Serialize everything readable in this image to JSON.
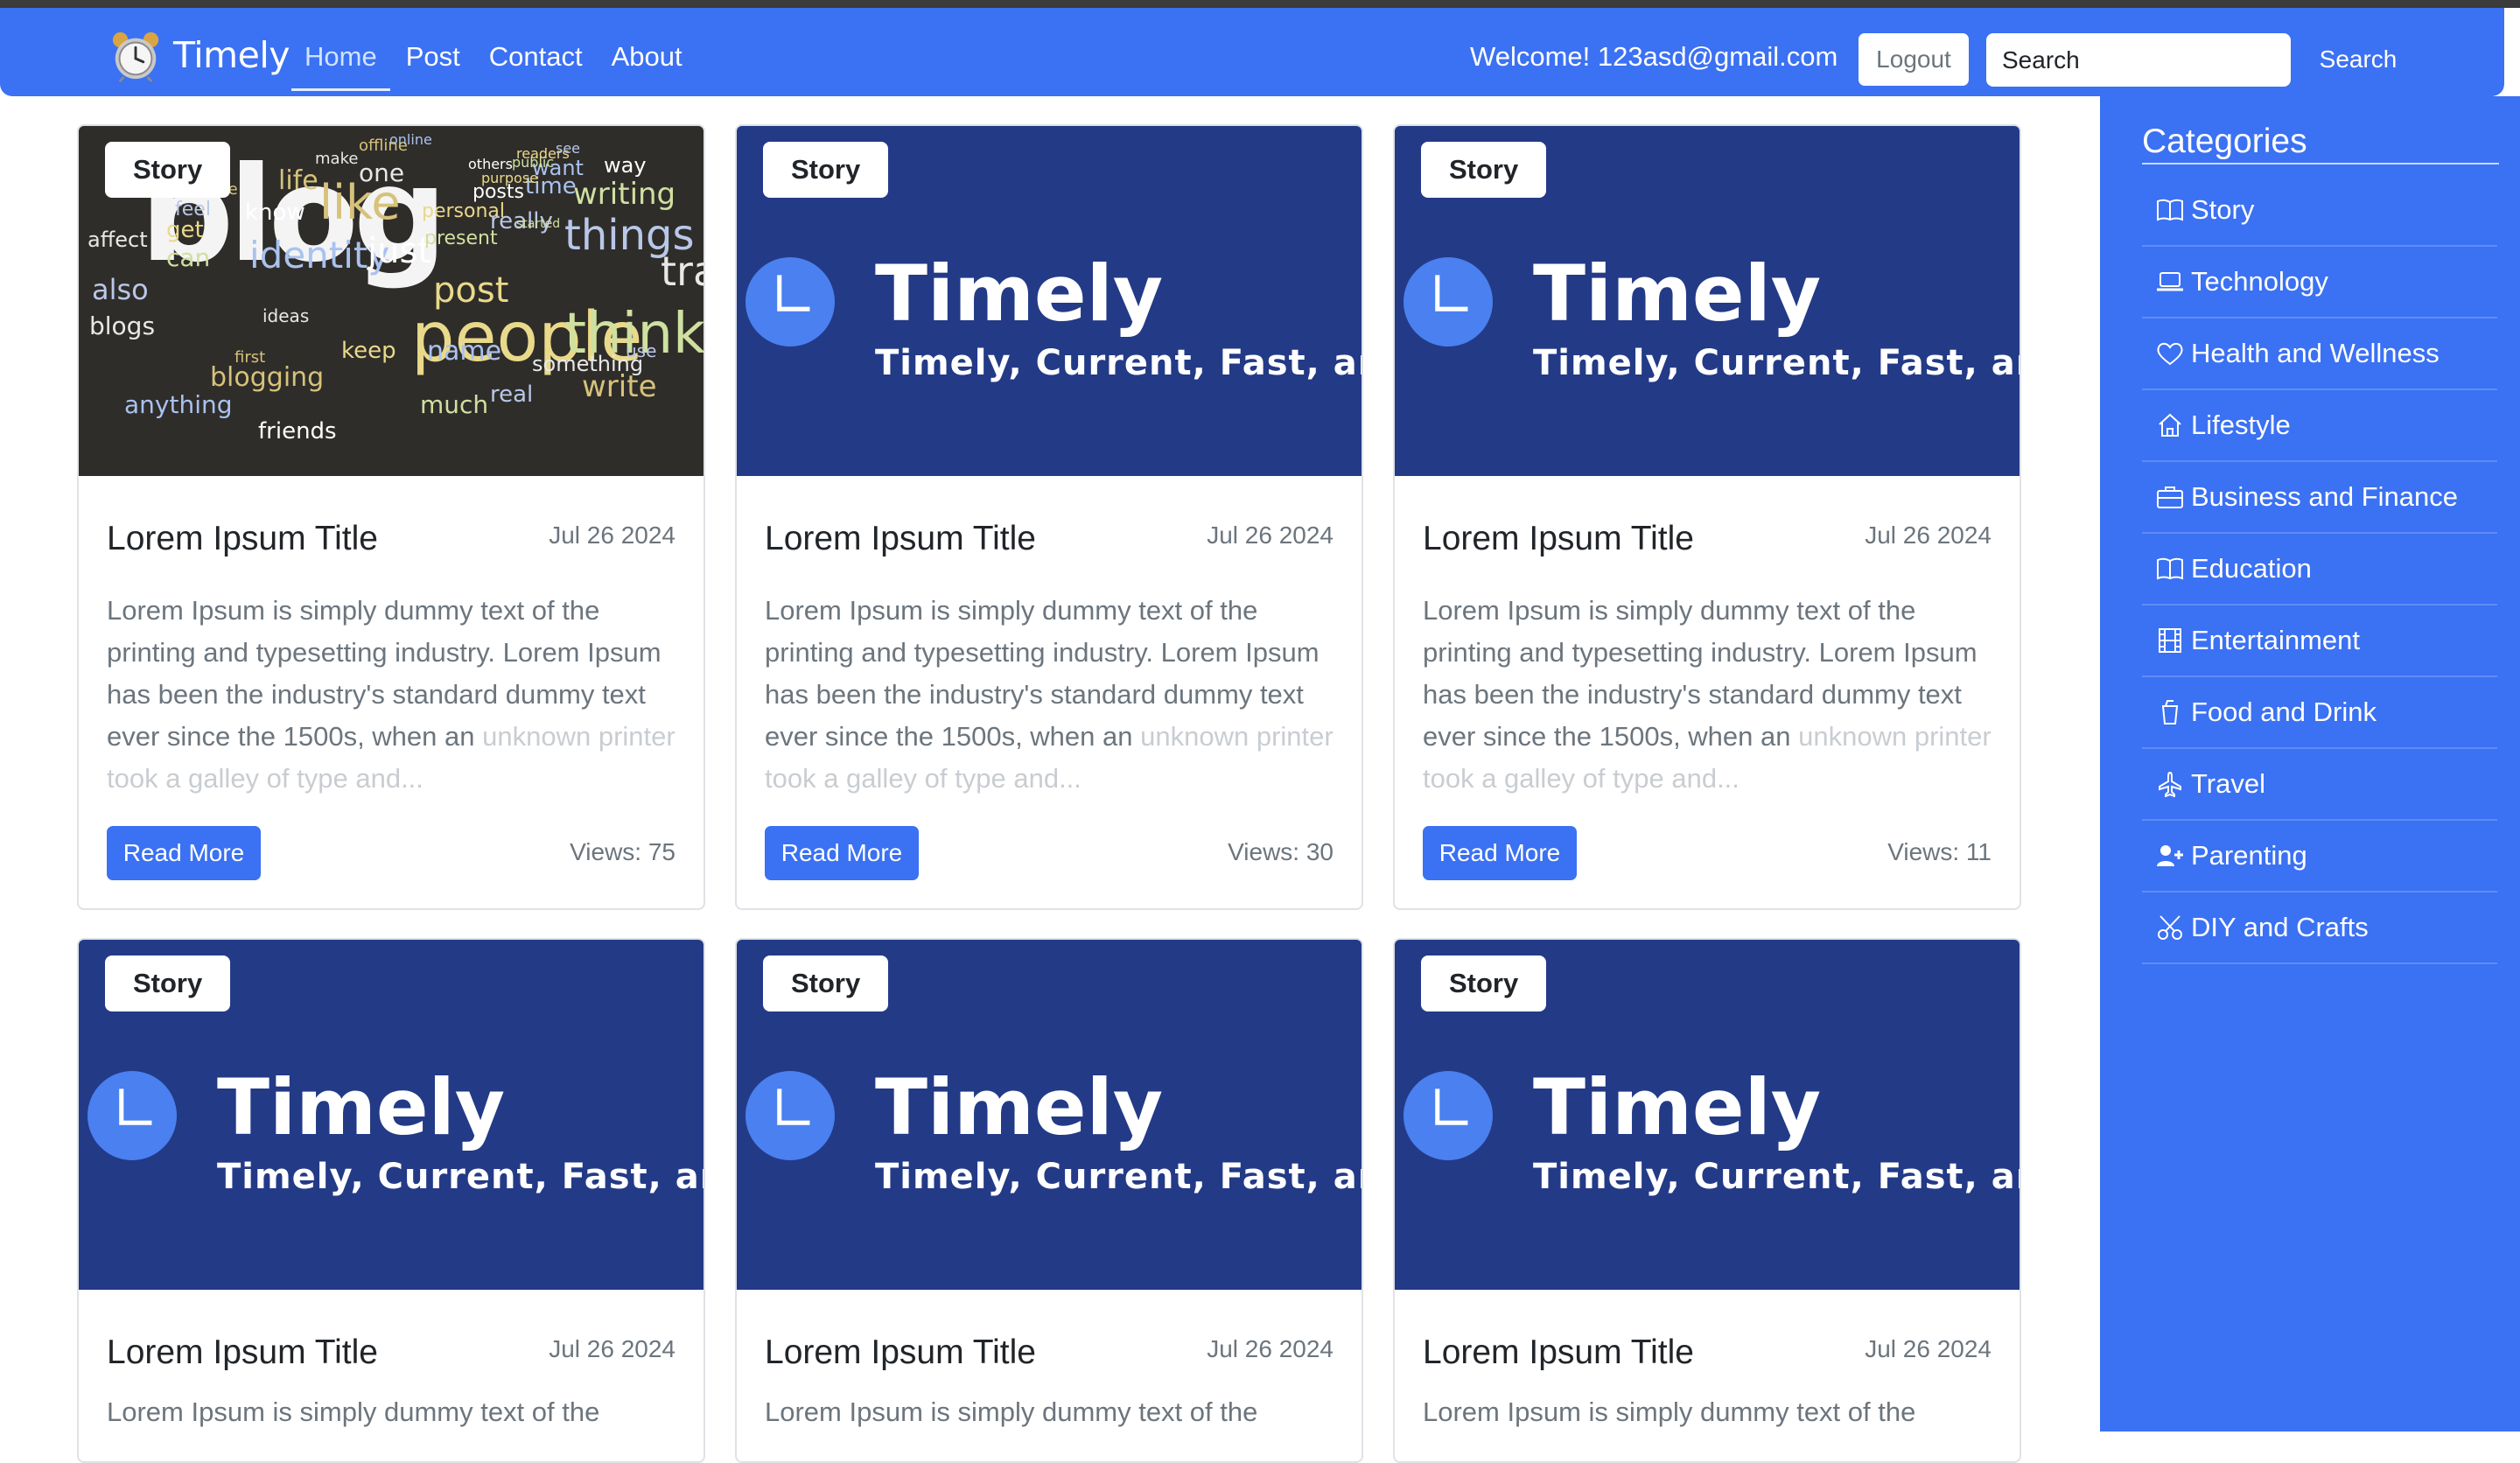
{
  "brand": {
    "name": "Timely"
  },
  "nav": {
    "items": [
      "Home",
      "Post",
      "Contact",
      "About"
    ]
  },
  "header": {
    "welcome": "Welcome! 123asd@gmail.com",
    "logout_label": "Logout",
    "search_placeholder": "Search",
    "search_button": "Search"
  },
  "sidebar": {
    "title": "Categories",
    "items": [
      {
        "label": "Story",
        "icon": "book-icon"
      },
      {
        "label": "Technology",
        "icon": "laptop-icon"
      },
      {
        "label": "Health and Wellness",
        "icon": "heart-icon"
      },
      {
        "label": "Lifestyle",
        "icon": "house-icon"
      },
      {
        "label": "Business and Finance",
        "icon": "briefcase-icon"
      },
      {
        "label": "Education",
        "icon": "book-icon"
      },
      {
        "label": "Entertainment",
        "icon": "film-icon"
      },
      {
        "label": "Food and Drink",
        "icon": "cup-icon"
      },
      {
        "label": "Travel",
        "icon": "airplane-icon"
      },
      {
        "label": "Parenting",
        "icon": "person-plus-icon"
      },
      {
        "label": "DIY and Crafts",
        "icon": "scissors-icon"
      }
    ]
  },
  "logo_image": {
    "title": "Timely",
    "tagline": "Timely, Current, Fast, an"
  },
  "blog_image": {
    "words": [
      "blog",
      "people",
      "think",
      "things",
      "traffic",
      "like",
      "identity",
      "just",
      "post",
      "writing",
      "also",
      "blogs",
      "blogging",
      "anything",
      "friends",
      "keep",
      "much",
      "real",
      "something",
      "write",
      "name",
      "know",
      "get",
      "can",
      "feel",
      "one",
      "life",
      "time",
      "posts",
      "personal",
      "present",
      "really",
      "affect",
      "describe",
      "want",
      "way",
      "readers",
      "public",
      "see",
      "make",
      "offline",
      "online",
      "others",
      "purpose",
      "started",
      "use",
      "ideas",
      "first"
    ]
  },
  "posts": [
    {
      "badge": "Story",
      "title": "Lorem Ipsum Title",
      "date": "Jul 26 2024",
      "excerpt": "Lorem Ipsum is simply dummy text of the printing and typesetting industry. Lorem Ipsum has been the industry's standard dummy text ever since the 1500s, when an",
      "excerpt_fade": "unknown printer took a galley of type and...",
      "read_more": "Read More",
      "views": "Views: 75",
      "image": "blog"
    },
    {
      "badge": "Story",
      "title": "Lorem Ipsum Title",
      "date": "Jul 26 2024",
      "excerpt": "Lorem Ipsum is simply dummy text of the printing and typesetting industry. Lorem Ipsum has been the industry's standard dummy text ever since the 1500s, when an",
      "excerpt_fade": "unknown printer took a galley of type and...",
      "read_more": "Read More",
      "views": "Views: 30",
      "image": "logo"
    },
    {
      "badge": "Story",
      "title": "Lorem Ipsum Title",
      "date": "Jul 26 2024",
      "excerpt": "Lorem Ipsum is simply dummy text of the printing and typesetting industry. Lorem Ipsum has been the industry's standard dummy text ever since the 1500s, when an",
      "excerpt_fade": "unknown printer took a galley of type and...",
      "read_more": "Read More",
      "views": "Views: 11",
      "image": "logo"
    },
    {
      "badge": "Story",
      "title": "Lorem Ipsum Title",
      "date": "Jul 26 2024",
      "excerpt": "Lorem Ipsum is simply dummy text of the",
      "excerpt_fade": "",
      "read_more": "",
      "views": "",
      "image": "logo"
    },
    {
      "badge": "Story",
      "title": "Lorem Ipsum Title",
      "date": "Jul 26 2024",
      "excerpt": "Lorem Ipsum is simply dummy text of the",
      "excerpt_fade": "",
      "read_more": "",
      "views": "",
      "image": "logo"
    },
    {
      "badge": "Story",
      "title": "Lorem Ipsum Title",
      "date": "Jul 26 2024",
      "excerpt": "Lorem Ipsum is simply dummy text of the",
      "excerpt_fade": "",
      "read_more": "",
      "views": "",
      "image": "logo"
    }
  ],
  "colors": {
    "primary": "#3b71f3",
    "logo_bg": "#233a87",
    "clock": "#4a80f0"
  }
}
